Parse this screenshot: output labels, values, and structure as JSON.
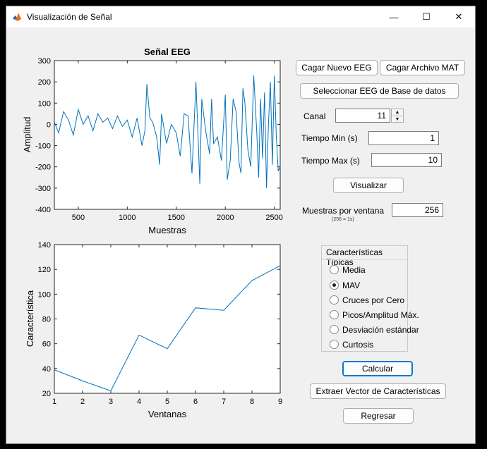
{
  "window": {
    "title": "Visualización de Señal",
    "minimize_glyph": "—",
    "maximize_glyph": "☐",
    "close_glyph": "✕"
  },
  "eeg_plot": {
    "title": "Señal EEG",
    "xlabel": "Muestras",
    "ylabel": "Amplitud",
    "xticks": [
      "500",
      "1000",
      "1500",
      "2000",
      "2500"
    ],
    "yticks": [
      "300",
      "200",
      "100",
      "0",
      "-100",
      "-200",
      "-300",
      "-400"
    ]
  },
  "feature_plot": {
    "xlabel": "Ventanas",
    "ylabel": "Característica",
    "xticks": [
      "1",
      "2",
      "3",
      "4",
      "5",
      "6",
      "7",
      "8",
      "9"
    ],
    "yticks": [
      "140",
      "120",
      "100",
      "80",
      "60",
      "40",
      "20"
    ]
  },
  "chart_data": [
    {
      "type": "line",
      "title": "Señal EEG",
      "xlabel": "Muestras",
      "ylabel": "Amplitud",
      "xlim": [
        256,
        2560
      ],
      "ylim": [
        -400,
        300
      ],
      "grid": false,
      "series": [
        {
          "x": [
            256,
            300,
            350,
            400,
            450,
            500,
            550,
            600,
            650,
            700,
            750,
            800,
            850,
            900,
            950,
            1000,
            1050,
            1100,
            1150,
            1180,
            1200,
            1230,
            1260,
            1300,
            1330,
            1350,
            1400,
            1450,
            1500,
            1540,
            1580,
            1620,
            1660,
            1700,
            1720,
            1740,
            1760,
            1800,
            1840,
            1860,
            1880,
            1920,
            1960,
            2000,
            2020,
            2050,
            2080,
            2110,
            2140,
            2160,
            2180,
            2200,
            2230,
            2260,
            2290,
            2320,
            2340,
            2360,
            2380,
            2400,
            2420,
            2440,
            2460,
            2480,
            2500,
            2520,
            2540,
            2560
          ],
          "y": [
            10,
            -40,
            60,
            20,
            -50,
            70,
            0,
            40,
            -30,
            50,
            10,
            30,
            -20,
            40,
            -10,
            20,
            -60,
            30,
            -100,
            -30,
            190,
            30,
            10,
            -60,
            -190,
            50,
            -90,
            0,
            -40,
            -150,
            50,
            40,
            -230,
            200,
            -30,
            -280,
            120,
            -30,
            -140,
            120,
            -90,
            -60,
            -170,
            140,
            -260,
            -170,
            120,
            60,
            -180,
            -230,
            170,
            100,
            -120,
            -200,
            230,
            -30,
            -250,
            120,
            -160,
            150,
            -300,
            0,
            200,
            -190,
            230,
            -50,
            -220,
            -200
          ]
        }
      ]
    },
    {
      "type": "line",
      "xlabel": "Ventanas",
      "ylabel": "Característica",
      "xlim": [
        1,
        9
      ],
      "ylim": [
        20,
        140
      ],
      "grid": false,
      "series": [
        {
          "x": [
            1,
            2,
            3,
            4,
            5,
            6,
            7,
            8,
            9
          ],
          "y": [
            39,
            30,
            22,
            67,
            56,
            89,
            87,
            111,
            123
          ]
        }
      ]
    }
  ],
  "controls": {
    "load_eeg": "Cagar Nuevo EEG",
    "load_mat": "Cagar Archivo MAT",
    "select_db": "Seleccionar EEG de Base de datos",
    "canal_label": "Canal",
    "canal_value": "11",
    "tmin_label": "Tiempo Min (s)",
    "tmin_value": "1",
    "tmax_label": "Tiempo Max (s)",
    "tmax_value": "10",
    "visualize": "Visualizar",
    "samples_label": "Muestras por ventana",
    "samples_value": "256",
    "samples_hint": "(256 = 1s)"
  },
  "features_panel": {
    "title": "Características Típicas",
    "options": [
      {
        "label": "Media",
        "selected": false
      },
      {
        "label": "MAV",
        "selected": true
      },
      {
        "label": "Cruces por Cero",
        "selected": false
      },
      {
        "label": "Picos/Amplitud Máx.",
        "selected": false
      },
      {
        "label": "Desviación estándar",
        "selected": false
      },
      {
        "label": "Curtosis",
        "selected": false
      }
    ]
  },
  "actions": {
    "calculate": "Calcular",
    "extract": "Extraer Vector de Características",
    "back": "Regresar"
  },
  "colors": {
    "plot_line": "#0072bd",
    "window_bg": "#f0f0f0",
    "focus_border": "#0078d7"
  }
}
